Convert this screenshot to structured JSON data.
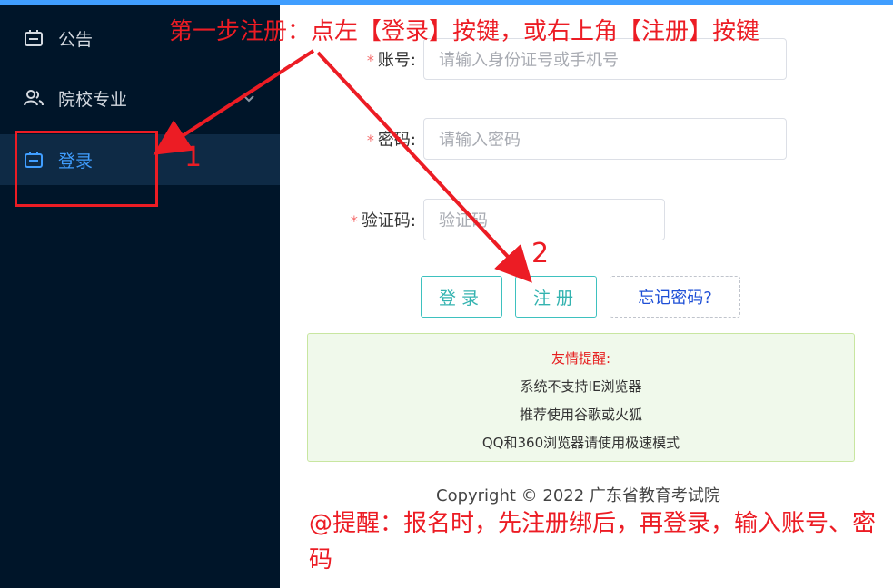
{
  "sidebar": {
    "items": [
      {
        "label": "公告",
        "icon": "notice-icon"
      },
      {
        "label": "院校专业",
        "icon": "school-icon"
      },
      {
        "label": "登录",
        "icon": "login-icon",
        "active": true
      }
    ]
  },
  "form": {
    "account": {
      "label": "账号:",
      "placeholder": "请输入身份证号或手机号"
    },
    "password": {
      "label": "密码:",
      "placeholder": "请输入密码"
    },
    "captcha": {
      "label": "验证码:",
      "placeholder": "验证码"
    },
    "required_mark": "*"
  },
  "buttons": {
    "login": "登录",
    "register": "注册",
    "forgot": "忘记密码?"
  },
  "notice": {
    "title": "友情提醒:",
    "lines": [
      "系统不支持IE浏览器",
      "推荐使用谷歌或火狐",
      "QQ和360浏览器请使用极速模式"
    ]
  },
  "footer": {
    "copyright": "Copyright © 2022 广东省教育考试院"
  },
  "annotations": {
    "top": "第一步注册：点左【登录】按键，或右上角【注册】按键",
    "num1": "1",
    "num2": "2",
    "bottom": "@提醒：报名时，先注册绑后，再登录，输入账号、密码"
  },
  "colors": {
    "accent": "#409eff",
    "sidebar_bg": "#001529",
    "annotation": "#ec1c24",
    "button": "#3ec1bf"
  }
}
